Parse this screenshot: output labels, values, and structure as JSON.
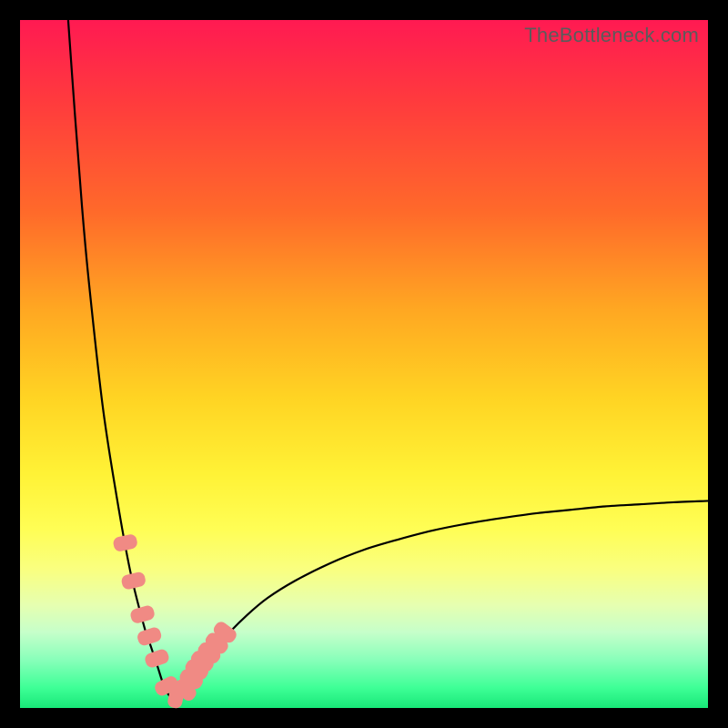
{
  "watermark": "TheBottleneck.com",
  "colors": {
    "frame": "#000000",
    "curve": "#000000",
    "marker": "#f08a84",
    "gradient_top": "#ff1a52",
    "gradient_bottom": "#18e878"
  },
  "chart_data": {
    "type": "line",
    "title": "",
    "xlabel": "",
    "ylabel": "",
    "xlim": [
      0,
      100
    ],
    "ylim": [
      0,
      100
    ],
    "note": "Curve depicts bottleneck percentage vs component balance; minimum ~0% at x≈22; rises to ~100% at x≈7 on the left branch and ~30% at x=100 on the right branch.",
    "series": [
      {
        "name": "bottleneck-curve",
        "x": [
          7,
          8,
          9,
          10,
          12,
          14,
          16,
          18,
          19,
          20,
          21,
          22,
          23,
          24,
          25,
          26,
          28,
          30,
          33,
          36,
          40,
          45,
          50,
          55,
          60,
          65,
          70,
          75,
          80,
          85,
          90,
          95,
          100
        ],
        "y": [
          100,
          86,
          73,
          62,
          44,
          31,
          20,
          12,
          9,
          6,
          3,
          1.5,
          1.5,
          2.5,
          4,
          5.5,
          8,
          10.5,
          13.5,
          16,
          18.5,
          21,
          23,
          24.5,
          25.8,
          26.8,
          27.6,
          28.3,
          28.8,
          29.3,
          29.6,
          29.9,
          30.1
        ]
      }
    ],
    "markers": {
      "name": "highlighted-points",
      "shape": "rounded-rect",
      "x": [
        15.3,
        16.5,
        17.8,
        18.8,
        19.9,
        21.3,
        22.7,
        24.0,
        24.9,
        25.7,
        26.5,
        27.5,
        28.6,
        29.8
      ],
      "y": [
        24.0,
        18.5,
        13.6,
        10.4,
        7.2,
        3.2,
        1.7,
        2.6,
        4.2,
        5.6,
        6.8,
        8.0,
        9.4,
        11.0
      ]
    }
  }
}
